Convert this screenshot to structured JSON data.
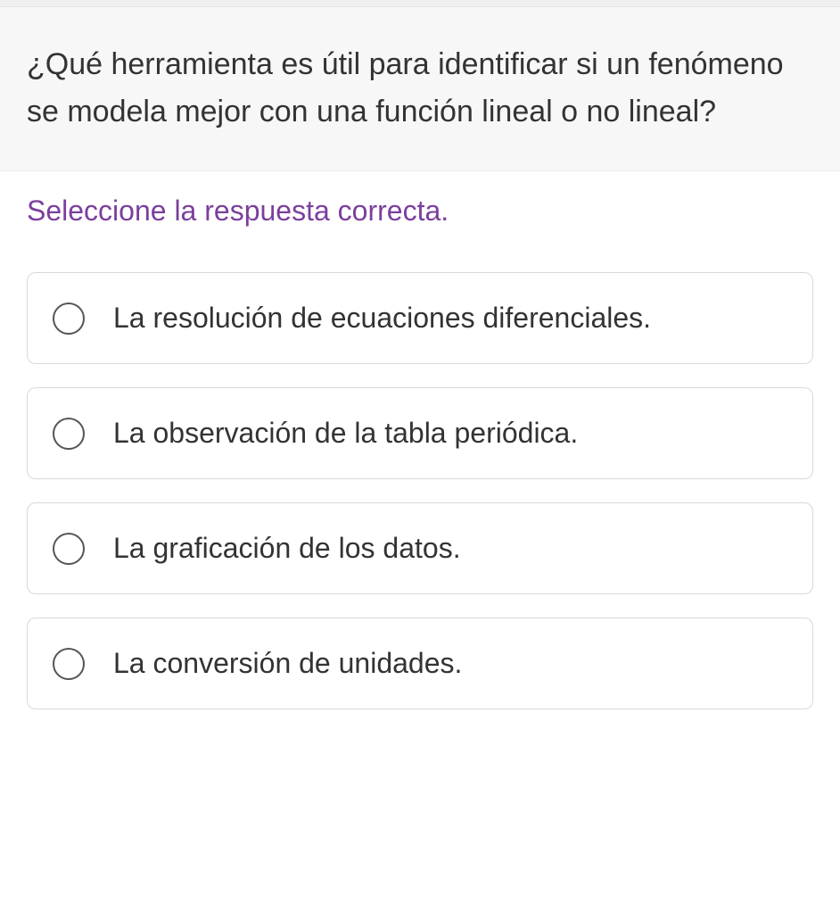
{
  "question": "¿Qué herramienta es útil para identificar si un fenómeno se modela mejor con una función lineal o no lineal?",
  "instruction": "Seleccione la respuesta correcta.",
  "options": [
    {
      "label": "La resolución de ecuaciones diferenciales."
    },
    {
      "label": "La observación de la tabla periódica."
    },
    {
      "label": "La graficación de los datos."
    },
    {
      "label": "La conversión de unidades."
    }
  ]
}
